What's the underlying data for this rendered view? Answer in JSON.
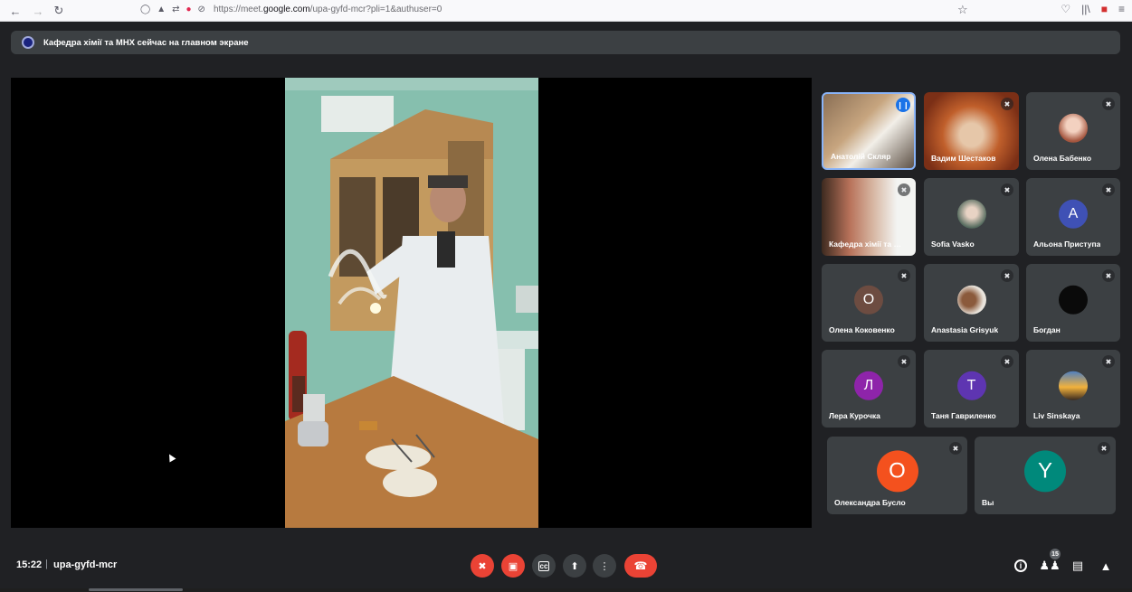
{
  "browser": {
    "url_prefix": "https://meet.",
    "url_host": "google.com",
    "url_path": "/upa-gyfd-mcr?pli=1&authuser=0"
  },
  "banner": {
    "text": "Кафедра хімії та МНХ сейчас на главном экране"
  },
  "participants": [
    {
      "name": "Анатолій Скляр",
      "type": "video",
      "speaking": true
    },
    {
      "name": "Вадим Шестаков",
      "type": "video",
      "muted": true
    },
    {
      "name": "Олена Бабенко",
      "type": "photo",
      "muted": true
    },
    {
      "name": "Кафедра хімії та МНХ",
      "type": "video",
      "muted": true
    },
    {
      "name": "Sofia Vasko",
      "type": "photo",
      "muted": true
    },
    {
      "name": "Альона Приступа",
      "type": "letter",
      "letter": "А",
      "color": "#3f51b5",
      "muted": true
    },
    {
      "name": "Олена Коковенко",
      "type": "letter",
      "letter": "О",
      "color": "#6d4c41",
      "muted": true
    },
    {
      "name": "Anastasia Grisyuk",
      "type": "photo",
      "muted": true
    },
    {
      "name": "Богдан",
      "type": "photo",
      "muted": true
    },
    {
      "name": "Лера Курочка",
      "type": "letter",
      "letter": "Л",
      "color": "#8e24aa",
      "muted": true
    },
    {
      "name": "Таня Гавриленко",
      "type": "letter",
      "letter": "Т",
      "color": "#5e35b1",
      "muted": true
    },
    {
      "name": "Liv Sinskaya",
      "type": "photo",
      "muted": true
    },
    {
      "name": "Олександра Бусло",
      "type": "letter",
      "letter": "О",
      "color": "#f4511e",
      "muted": true
    },
    {
      "name": "Вы",
      "type": "letter",
      "letter": "Y",
      "color": "#00897b",
      "muted": true
    }
  ],
  "bottom": {
    "time": "15:22",
    "separator": "|",
    "meeting_code": "upa-gyfd-mcr",
    "participant_count": "15"
  },
  "colors": {
    "background": "#202124",
    "tile": "#3c4043",
    "danger": "#ea4335",
    "active_border": "#8ab4f8"
  }
}
